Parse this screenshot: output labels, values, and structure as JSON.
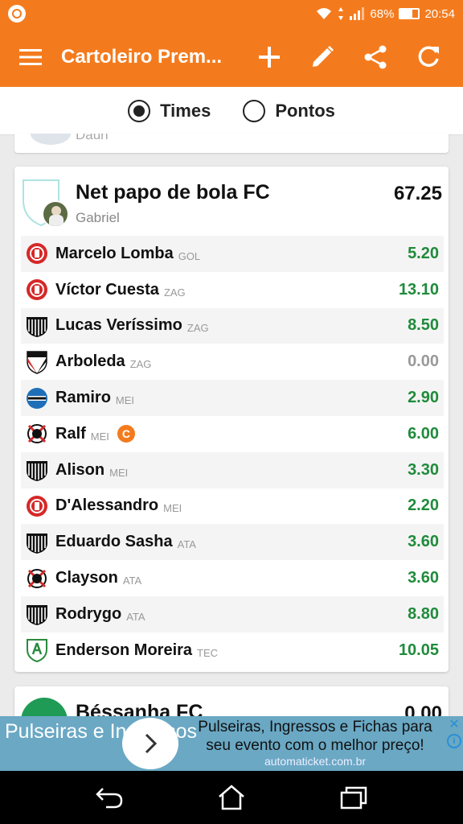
{
  "status_bar": {
    "battery": "68%",
    "battery_level": 0.68,
    "time": "20:54"
  },
  "toolbar": {
    "title": "Cartoleiro Prem..."
  },
  "radio_group": {
    "options": [
      {
        "label": "Times",
        "selected": true
      },
      {
        "label": "Pontos",
        "selected": false
      }
    ]
  },
  "previous_card": {
    "owner_fragment": "Daun"
  },
  "team_card": {
    "name": "Net papo de bola FC",
    "owner": "Gabriel",
    "score": "67.25",
    "players": [
      {
        "name": "Marcelo Lomba",
        "pos": "GOL",
        "pts": "5.20",
        "club": "internacional",
        "captain": false
      },
      {
        "name": "Víctor Cuesta",
        "pos": "ZAG",
        "pts": "13.10",
        "club": "internacional",
        "captain": false
      },
      {
        "name": "Lucas Veríssimo",
        "pos": "ZAG",
        "pts": "8.50",
        "club": "santos",
        "captain": false
      },
      {
        "name": "Arboleda",
        "pos": "ZAG",
        "pts": "0.00",
        "club": "sao-paulo",
        "captain": false
      },
      {
        "name": "Ramiro",
        "pos": "MEI",
        "pts": "2.90",
        "club": "gremio",
        "captain": false
      },
      {
        "name": "Ralf",
        "pos": "MEI",
        "pts": "6.00",
        "club": "corinthians",
        "captain": true
      },
      {
        "name": "Alison",
        "pos": "MEI",
        "pts": "3.30",
        "club": "santos",
        "captain": false
      },
      {
        "name": "D'Alessandro",
        "pos": "MEI",
        "pts": "2.20",
        "club": "internacional",
        "captain": false
      },
      {
        "name": "Eduardo Sasha",
        "pos": "ATA",
        "pts": "3.60",
        "club": "santos",
        "captain": false
      },
      {
        "name": "Clayson",
        "pos": "ATA",
        "pts": "3.60",
        "club": "corinthians",
        "captain": false
      },
      {
        "name": "Rodrygo",
        "pos": "ATA",
        "pts": "8.80",
        "club": "santos",
        "captain": false
      },
      {
        "name": "Enderson Moreira",
        "pos": "TEC",
        "pts": "10.05",
        "club": "america-mg",
        "captain": false
      }
    ],
    "captain_badge": "C"
  },
  "next_card": {
    "name": "Béssanha FC",
    "score": "0.00"
  },
  "ad": {
    "left_text": "Pulseiras e Ingressos",
    "headline": "Pulseiras, Ingressos e Fichas para seu evento com o melhor preço!",
    "domain": "automaticket.com.br"
  },
  "colors": {
    "brand": "#f47b1d",
    "points_green": "#1f8b3b",
    "points_zero": "#999999",
    "ad_bg": "#6aa8c4"
  },
  "icons": {
    "toolbar": [
      "menu-icon",
      "add-icon",
      "edit-icon",
      "share-icon",
      "refresh-icon"
    ],
    "status": [
      "whatsapp-icon",
      "wifi-icon",
      "signal-icon",
      "battery-icon"
    ],
    "nav": [
      "back-icon",
      "home-icon",
      "recents-icon"
    ]
  }
}
